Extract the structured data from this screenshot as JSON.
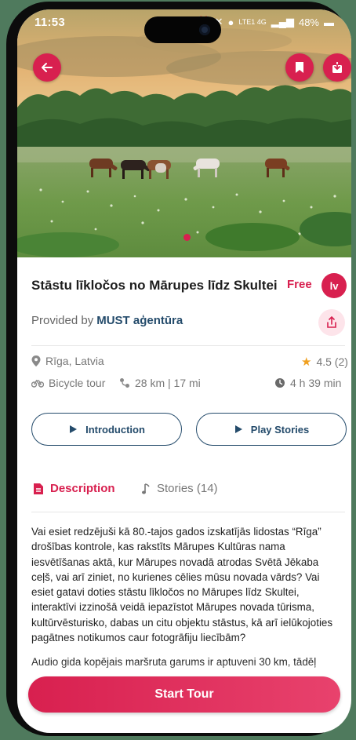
{
  "status_bar": {
    "time": "11:53",
    "battery": "48%",
    "network": "LTE1 4G"
  },
  "hero": {
    "image_description_icons": [
      "back-arrow-icon",
      "bookmark-icon",
      "download-icon"
    ],
    "slide_count": 1,
    "active_slide": 1
  },
  "tour": {
    "title": "Stāstu līkločos no Mārupes līdz Skultei",
    "price": "Free",
    "language_badge": "lv",
    "provider_prefix": "Provided by",
    "provider_name": "MUST aģentūra",
    "location": "Rīga, Latvia",
    "rating": "4.5 (2)",
    "type": "Bicycle tour",
    "distance": "28 km | 17 mi",
    "duration": "4 h 39 min"
  },
  "buttons": {
    "introduction": "Introduction",
    "play_stories": "Play Stories",
    "start_tour": "Start Tour"
  },
  "tabs": {
    "description": "Description",
    "stories": "Stories (14)"
  },
  "description": {
    "paragraph1": "Vai esiet redzējuši kā 80.-tajos gados izskatījās lidostas “Rīga” drošības kontrole, kas rakstīts Mārupes Kultūras nama iesvētīšanas aktā, kur Mārupes novadā atrodas Svētā Jēkaba ceļš, vai arī ziniet, no kurienes cēlies mūsu novada vārds? Vai esiet gatavi doties stāstu līkločos no Mārupes līdz Skultei, interaktīvi izzinošā veidā iepazīstot Mārupes novada tūrisma, kultūrvēsturisko, dabas un citu objektu stāstus, kā arī ielūkojoties pagātnes notikumos caur fotogrāfiju liecībām?",
    "paragraph2": "Audio gida kopējais maršruta garums ir aptuveni 30 km, tādēļ"
  },
  "colors": {
    "accent": "#d8204f",
    "navy": "#244b6b",
    "star": "#f0a020"
  }
}
